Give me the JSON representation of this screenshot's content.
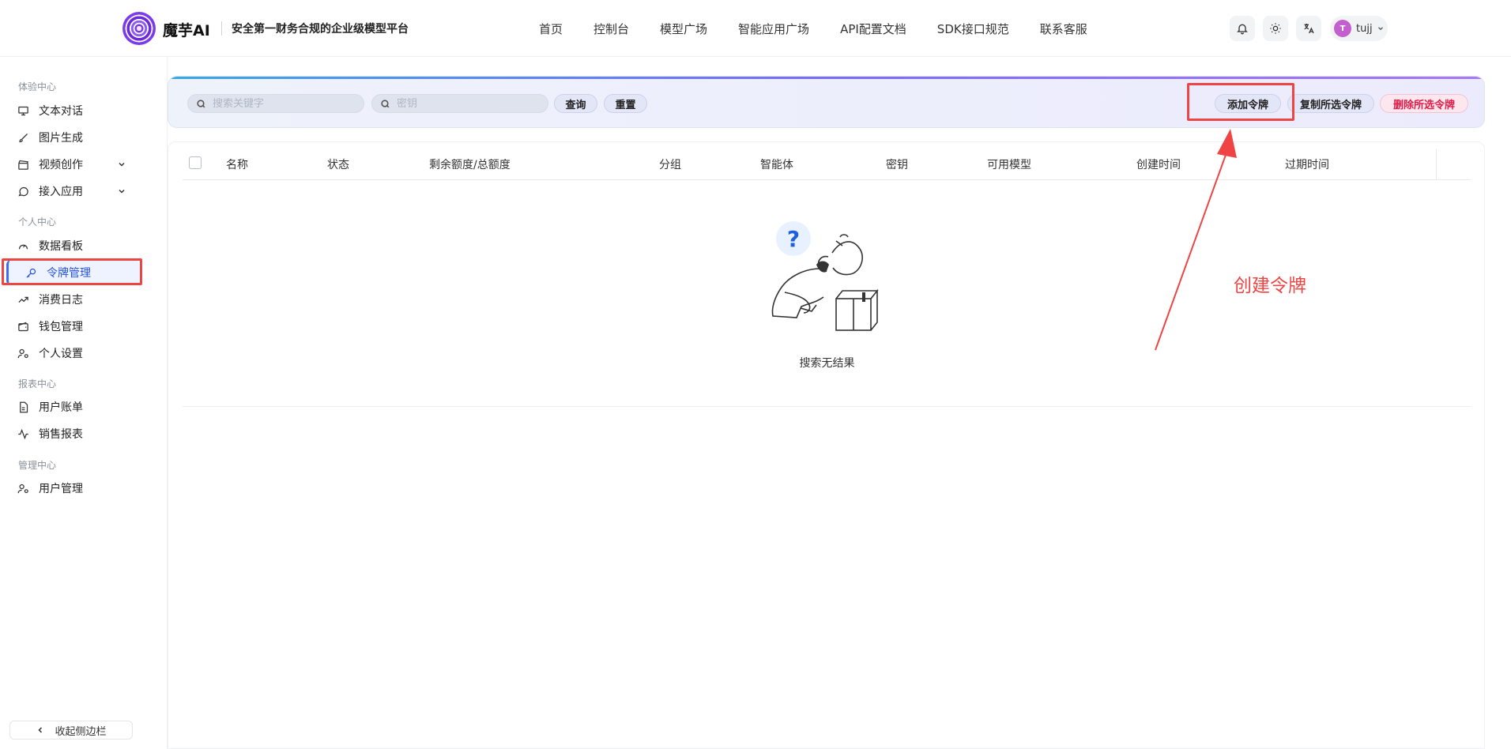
{
  "header": {
    "brand": "魔芋AI",
    "tagline": "安全第一财务合规的企业级模型平台",
    "nav": [
      "首页",
      "控制台",
      "模型广场",
      "智能应用广场",
      "API配置文档",
      "SDK接口规范",
      "联系客服"
    ],
    "user": {
      "avatar_letter": "T",
      "name": "tujj"
    },
    "avatar_color": "#c35fcf"
  },
  "sidebar": {
    "sections": [
      {
        "label": "体验中心",
        "items": [
          "文本对话",
          "图片生成",
          "视频创作",
          "接入应用"
        ]
      },
      {
        "label": "个人中心",
        "items": [
          "数据看板",
          "令牌管理",
          "消费日志",
          "钱包管理",
          "个人设置"
        ]
      },
      {
        "label": "报表中心",
        "items": [
          "用户账单",
          "销售报表"
        ]
      },
      {
        "label": "管理中心",
        "items": [
          "用户管理"
        ]
      }
    ],
    "active_item": "令牌管理",
    "collapse_label": "收起侧边栏"
  },
  "toolbar": {
    "keyword_placeholder": "搜索关键字",
    "key_placeholder": "密钥",
    "query_label": "查询",
    "reset_label": "重置",
    "add_label": "添加令牌",
    "copy_label": "复制所选令牌",
    "delete_label": "删除所选令牌"
  },
  "table": {
    "columns": [
      "名称",
      "状态",
      "剩余额度/总额度",
      "分组",
      "智能体",
      "密钥",
      "可用模型",
      "创建时间",
      "过期时间"
    ],
    "rows": [],
    "empty_text": "搜索无结果"
  },
  "annotation": {
    "text": "创建令牌",
    "color": "#ef4444"
  }
}
